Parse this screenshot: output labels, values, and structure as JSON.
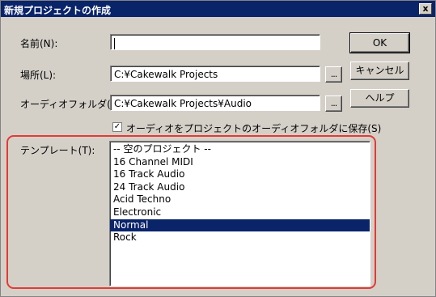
{
  "dialog": {
    "title": "新規プロジェクトの作成",
    "close_label": "x"
  },
  "fields": {
    "name_label": "名前(N):",
    "name_value": "",
    "location_label": "場所(L):",
    "location_value": "C:¥Cakewalk Projects",
    "audio_folder_label": "オーディオフォルダ(A):",
    "audio_folder_value": "C:¥Cakewalk Projects¥Audio",
    "browse_label": "...",
    "checkbox_label": "オーディオをプロジェクトのオーディオフォルダに保存(S)",
    "checkbox_checked": true,
    "checkbox_mark": "✓"
  },
  "buttons": {
    "ok": "OK",
    "cancel": "キャンセル",
    "help": "ヘルプ"
  },
  "template": {
    "label": "テンプレート(T):",
    "items": [
      "-- 空のプロジェクト --",
      "16 Channel MIDI",
      "16 Track Audio",
      "24 Track Audio",
      "Acid Techno",
      "Electronic",
      "Normal",
      "Rock"
    ],
    "selected": "Normal"
  },
  "colors": {
    "titlebar": "#0a246a",
    "dialog_bg": "#d4d0c8",
    "highlight_border": "#e53935",
    "selection": "#0a246a"
  }
}
